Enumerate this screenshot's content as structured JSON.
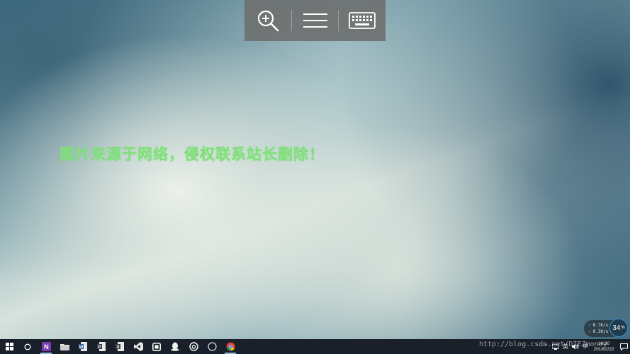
{
  "toolbar": {
    "buttons": [
      {
        "icon": "zoom-in-icon"
      },
      {
        "icon": "menu-icon"
      },
      {
        "icon": "keyboard-icon"
      }
    ]
  },
  "watermark": {
    "text": "图片来源于网络，侵权联系站长删除！",
    "color": "#7fe07a"
  },
  "net_widget": {
    "upload": "8.7K/s",
    "download": "0.3K/s",
    "percent": "34",
    "percent_unit": "%"
  },
  "taskbar": {
    "apps": [
      {
        "icon": "windows-start-icon"
      },
      {
        "icon": "cortana-search-icon"
      },
      {
        "icon": "onenote-icon"
      },
      {
        "icon": "file-explorer-icon"
      },
      {
        "icon": "word-doc-icon"
      },
      {
        "icon": "doc-icon"
      },
      {
        "icon": "doc-icon-2"
      },
      {
        "icon": "visual-studio-icon"
      },
      {
        "icon": "app-icon"
      },
      {
        "icon": "qq-icon"
      },
      {
        "icon": "netease-music-icon"
      },
      {
        "icon": "circle-app-icon"
      },
      {
        "icon": "chrome-icon"
      }
    ],
    "blog_url": "http://blog.csdn.net/DIEZmoney",
    "tray": {
      "input_method": "英",
      "clock_time": "16:30",
      "clock_date": "2018/2/22"
    }
  }
}
